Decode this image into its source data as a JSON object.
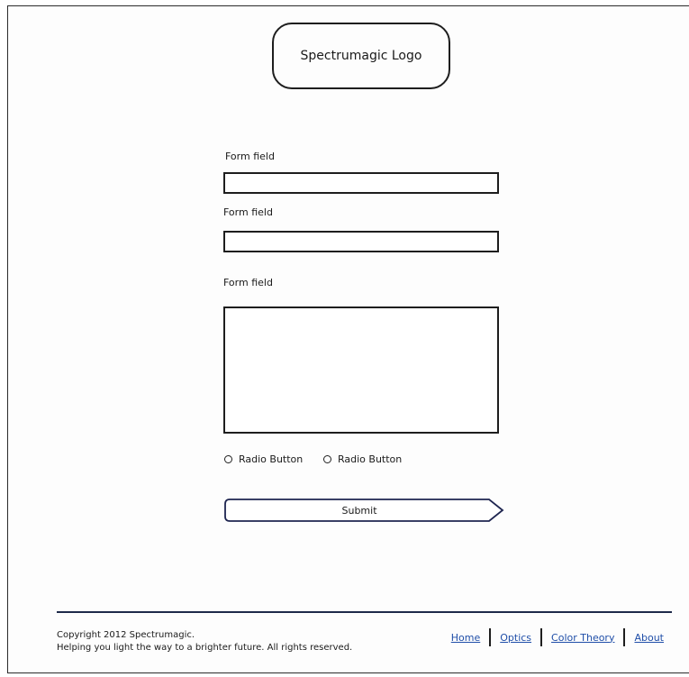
{
  "logo": {
    "text": "Spectrumagic Logo"
  },
  "form": {
    "fields": [
      {
        "label": "Form field",
        "value": ""
      },
      {
        "label": "Form field",
        "value": ""
      },
      {
        "label": "Form field",
        "value": ""
      }
    ],
    "radios": [
      {
        "label": "Radio Button",
        "checked": false
      },
      {
        "label": "Radio Button",
        "checked": false
      }
    ],
    "submit_label": "Submit"
  },
  "footer": {
    "copyright_line1": "Copyright 2012 Spectrumagic.",
    "copyright_line2": "Helping you light the way to a brighter future. All rights reserved.",
    "nav": [
      {
        "label": "Home"
      },
      {
        "label": "Optics"
      },
      {
        "label": "Color Theory"
      },
      {
        "label": "About"
      }
    ]
  },
  "colors": {
    "link": "#1f4ea8",
    "outline": "#1e1e1e",
    "footer_rule": "#1e2a4a"
  }
}
